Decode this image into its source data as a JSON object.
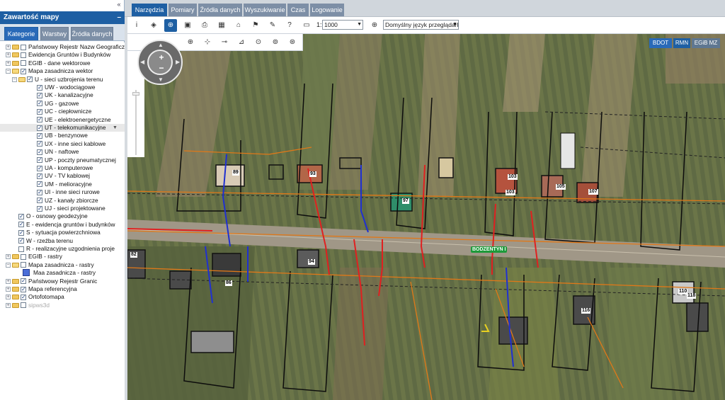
{
  "sidebar": {
    "collapse_glyph": "«",
    "panel_title": "Zawartość mapy",
    "minimize_glyph": "–",
    "tabs": [
      {
        "label": "Kategorie",
        "active": true
      },
      {
        "label": "Warstwy",
        "active": false
      },
      {
        "label": "Źródła danych",
        "active": false
      }
    ],
    "tree": [
      {
        "label": "Państwowy Rejestr Nazw Geograficzn",
        "depth": 0,
        "expander": "+",
        "checked": false,
        "icon": "folder"
      },
      {
        "label": "Ewidencja Gruntów i Budynków",
        "depth": 0,
        "expander": "+",
        "checked": false,
        "icon": "folder"
      },
      {
        "label": "EGIB - dane wektorowe",
        "depth": 0,
        "expander": "+",
        "checked": false,
        "icon": "folder"
      },
      {
        "label": "Mapa zasadnicza wektor",
        "depth": 0,
        "expander": "−",
        "checked": true,
        "icon": "folder-open"
      },
      {
        "label": "U - sieci uzbrojenia terenu",
        "depth": 1,
        "expander": "−",
        "checked": true,
        "icon": "folder-open"
      },
      {
        "label": "UW - wodociągowe",
        "depth": 2,
        "checked": true
      },
      {
        "label": "UK - kanalizacyjne",
        "depth": 2,
        "checked": true
      },
      {
        "label": "UG - gazowe",
        "depth": 2,
        "checked": true
      },
      {
        "label": "UC - ciepłownicze",
        "depth": 2,
        "checked": true
      },
      {
        "label": "UE - elektroenergetyczne",
        "depth": 2,
        "checked": true
      },
      {
        "label": "UT - telekomunikacyjne",
        "depth": 2,
        "checked": true,
        "highlighted": true
      },
      {
        "label": "UB - benzynowe",
        "depth": 2,
        "checked": true
      },
      {
        "label": "UX - inne sieci kablowe",
        "depth": 2,
        "checked": true
      },
      {
        "label": "UN - naftowe",
        "depth": 2,
        "checked": true
      },
      {
        "label": "UP - poczty pneumatycznej",
        "depth": 2,
        "checked": true
      },
      {
        "label": "UA - komputerowe",
        "depth": 2,
        "checked": true
      },
      {
        "label": "UV - TV kablowej",
        "depth": 2,
        "checked": true
      },
      {
        "label": "UM - melioracyjne",
        "depth": 2,
        "checked": true
      },
      {
        "label": "UI - inne sieci rurowe",
        "depth": 2,
        "checked": true
      },
      {
        "label": "UZ - kanały zbiorcze",
        "depth": 2,
        "checked": true
      },
      {
        "label": "UJ - sieci projektowane",
        "depth": 2,
        "checked": true
      },
      {
        "label": "O - osnowy geodezyjne",
        "depth": 1,
        "checked": true
      },
      {
        "label": "E - ewidencja gruntów i budynków",
        "depth": 1,
        "checked": true
      },
      {
        "label": "S - sytuacja powierzchniowa",
        "depth": 1,
        "checked": true
      },
      {
        "label": "W - rzeźba terenu",
        "depth": 1,
        "checked": true
      },
      {
        "label": "R - realizacyjne uzgodnienia proje",
        "depth": 1,
        "checked": false
      },
      {
        "label": "EGIB - rastry",
        "depth": 0,
        "expander": "+",
        "checked": false,
        "icon": "folder"
      },
      {
        "label": "Mapa zasadnicza - rastry",
        "depth": 0,
        "expander": "−",
        "checked": false,
        "icon": "folder-open"
      },
      {
        "label": "Maa zasadnicza - rastry",
        "depth": 1,
        "icon": "raster"
      },
      {
        "label": "Państwowy Rejestr Granic",
        "depth": 0,
        "expander": "+",
        "checked": true,
        "icon": "folder"
      },
      {
        "label": "Mapa referencyjna",
        "depth": 0,
        "expander": "+",
        "checked": true,
        "icon": "folder"
      },
      {
        "label": "Ortofotomapa",
        "depth": 0,
        "expander": "+",
        "checked": true,
        "icon": "folder"
      },
      {
        "label": "sipws3d",
        "depth": 0,
        "expander": "+",
        "checked": false,
        "icon": "folder",
        "dim": true
      }
    ]
  },
  "top_tabs": [
    {
      "label": "Narzędzia",
      "active": true
    },
    {
      "label": "Pomiary",
      "active": false
    },
    {
      "label": "Źródła danych",
      "active": false
    },
    {
      "label": "Wyszukiwanie",
      "active": false
    },
    {
      "label": "Czas",
      "active": false
    },
    {
      "label": "Logowanie",
      "active": false
    }
  ],
  "toolbar": {
    "row1_icons": [
      "info-icon",
      "layers-icon",
      "zoom-active-icon",
      "save-icon",
      "print-icon",
      "table-icon",
      "home-icon",
      "bookmark-icon",
      "tag-icon",
      "help-icon",
      "image-icon"
    ],
    "row1_glyphs": [
      "i",
      "◈",
      "⊕",
      "▣",
      "⎙",
      "▦",
      "⌂",
      "⚑",
      "✎",
      "?",
      "▭"
    ],
    "row2_icons": [
      "globe-icon",
      "add-point-icon",
      "remove-point-icon",
      "measure-icon",
      "edit-layer-icon",
      "view-layer-icon",
      "draw-icon"
    ],
    "row2_glyphs": [
      "⊕",
      "⊹",
      "⊸",
      "⊿",
      "⊙",
      "⊚",
      "⊛"
    ],
    "scale_prefix": "1:",
    "scale_value": "1000",
    "lang_select": "Domyślny język przeglądarki",
    "zoom_search_glyph": "⊕"
  },
  "layer_buttons": [
    {
      "label": "BDOT",
      "active": true
    },
    {
      "label": "RMN",
      "active": true
    },
    {
      "label": "EGiB MZ",
      "active": false
    }
  ],
  "navigation": {
    "zoom_in": "+",
    "zoom_out": "−",
    "zoom_level": 0.96
  },
  "map_labels": {
    "street": "BODZENTYN I",
    "house_numbers": [
      "89",
      "93",
      "97",
      "103",
      "103",
      "105",
      "107",
      "82",
      "94",
      "86",
      "110",
      "118",
      "116"
    ]
  },
  "colors": {
    "accent": "#1e5fa3",
    "tab_inactive": "#7d8fa6",
    "utility_red": "#e02020",
    "utility_blue": "#2030d0",
    "utility_orange": "#e07818"
  }
}
